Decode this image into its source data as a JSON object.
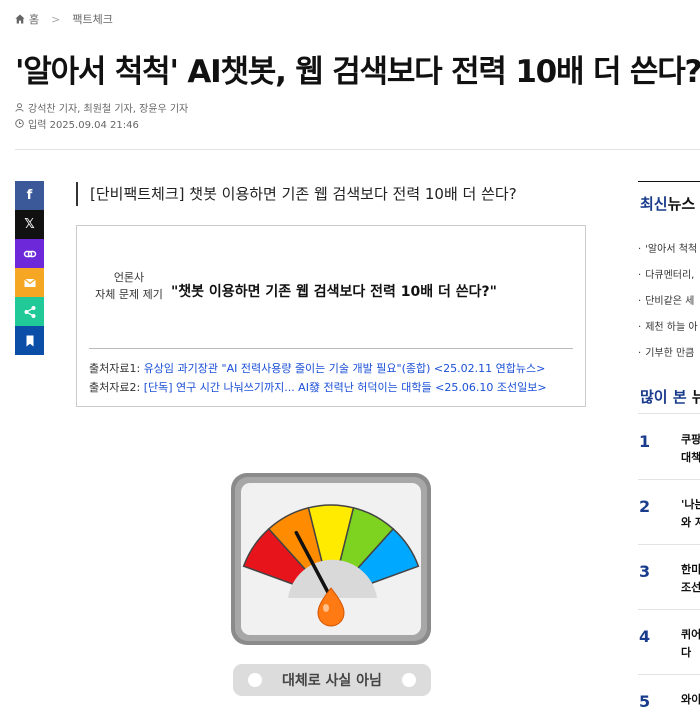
{
  "breadcrumb": {
    "home": "홈",
    "section": "팩트체크"
  },
  "article": {
    "title": "'알아서 척척' AI챗봇, 웹 검색보다 전력 10배 더 쓴다?",
    "authors": "강석찬 기자, 최원철 기자, 장윤우 기자",
    "date": "입력 2025.09.04 21:46",
    "subtitle": "[단비팩트체크] 챗봇 이용하면 기존 웹 검색보다 전력 10배 더 쓴다?"
  },
  "factbox": {
    "label_line1": "언론사",
    "label_line2": "자체 문제 제기",
    "quote": "\"챗봇 이용하면 기존 웹 검색보다 전력 10배 더 쓴다?\"",
    "sources": [
      {
        "prefix": "출처자료1: ",
        "link": "유상임 과기장관 \"AI 전력사용량 줄이는 기술 개발 필요\"(종합) <25.02.11 연합뉴스>"
      },
      {
        "prefix": "출처자료2: ",
        "link": "[단독] 연구 시간 나눠쓰기까지... AI發 전력난 허덕이는 대학들 <25.06.10 조선일보>"
      }
    ]
  },
  "gauge": {
    "verdict": "대체로 사실 아님",
    "level": 0.3,
    "colors": [
      "#e8141b",
      "#ff8c00",
      "#ffeb00",
      "#7ed321",
      "#00a8ff"
    ]
  },
  "share_buttons": [
    {
      "icon": "facebook-icon",
      "glyph": "f",
      "color": "#3b5998"
    },
    {
      "icon": "x-icon",
      "glyph": "𝕏",
      "color": "#111111"
    },
    {
      "icon": "link-icon",
      "glyph": "",
      "color": "#6d28d9"
    },
    {
      "icon": "mail-icon",
      "glyph": "",
      "color": "#f5a623"
    },
    {
      "icon": "share-icon",
      "glyph": "",
      "color": "#20c997"
    },
    {
      "icon": "bookmark-icon",
      "glyph": "",
      "color": "#0a4ea8"
    }
  ],
  "sidebar": {
    "latest_title_accent": "최신",
    "latest_title_rest": "뉴스",
    "latest_items": [
      "'알아서 척척",
      "다큐멘터리,",
      "단비같은 세",
      "제천 하늘 아",
      "기부한 만큼"
    ],
    "popular_title_accent": "많이 본",
    "popular_title_rest": " 뉴",
    "popular_items": [
      {
        "rank": "1",
        "line1": "쿠팡",
        "line2": "대책"
      },
      {
        "rank": "2",
        "line1": "'나는",
        "line2": "와 자"
      },
      {
        "rank": "3",
        "line1": "한미",
        "line2": "조선"
      },
      {
        "rank": "4",
        "line1": "퀴어",
        "line2": "다"
      },
      {
        "rank": "5",
        "line1": "와이",
        "line2": ""
      }
    ]
  }
}
